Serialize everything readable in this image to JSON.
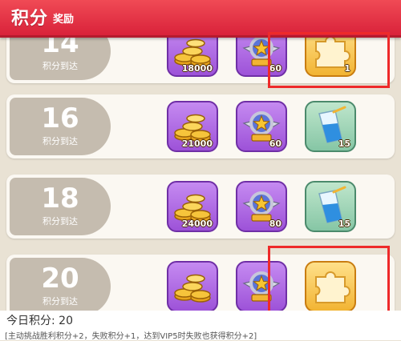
{
  "header": {
    "title": "积分",
    "subtitle": "奖励"
  },
  "tiers": [
    {
      "points": "14",
      "label": "积分到达",
      "rewards": [
        {
          "icon": "gold-coins-icon",
          "qty": "18000"
        },
        {
          "icon": "wing-badge-icon",
          "qty": "60"
        },
        {
          "icon": "puzzle-piece-icon",
          "qty": "1"
        }
      ]
    },
    {
      "points": "16",
      "label": "积分到达",
      "rewards": [
        {
          "icon": "gold-coins-icon",
          "qty": "21000"
        },
        {
          "icon": "wing-badge-icon",
          "qty": "60"
        },
        {
          "icon": "drink-cup-icon",
          "qty": "15"
        }
      ]
    },
    {
      "points": "18",
      "label": "积分到达",
      "rewards": [
        {
          "icon": "gold-coins-icon",
          "qty": "24000"
        },
        {
          "icon": "wing-badge-icon",
          "qty": "80"
        },
        {
          "icon": "drink-cup-icon",
          "qty": "15"
        }
      ]
    },
    {
      "points": "20",
      "label": "积分到达",
      "rewards": [
        {
          "icon": "gold-coins-icon",
          "qty": ""
        },
        {
          "icon": "wing-badge-icon",
          "qty": ""
        },
        {
          "icon": "puzzle-piece-icon",
          "qty": ""
        }
      ]
    }
  ],
  "footer": {
    "today_label": "今日积分:",
    "today_value": "20",
    "rule_text": "[主动挑战胜利积分+2，失败积分+1，达到VIP5时失败也获得积分+2]"
  },
  "colors": {
    "header": "#e33547",
    "highlight": "#ee2a2a",
    "tier_badge": "#c5bcaf"
  }
}
